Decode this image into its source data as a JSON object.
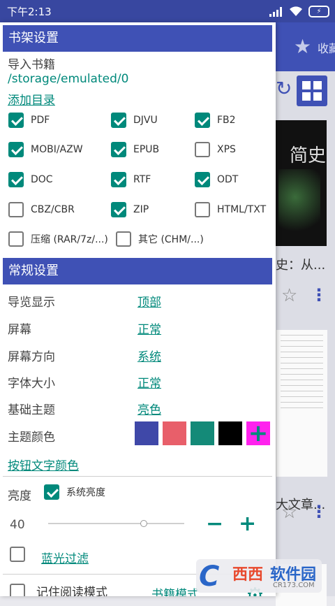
{
  "statusbar": {
    "time": "下午2:13",
    "battery": "⚡"
  },
  "background_app": {
    "toolbar_text": "收藏",
    "book1_cover_title": "简史",
    "book1_title": "史：从...",
    "book2_title": "大文章..."
  },
  "library_settings": {
    "header": "书架设置",
    "import_label": "导入书籍",
    "path": "/storage/emulated/0",
    "add_directory": "添加目录",
    "formats": [
      {
        "label": "PDF",
        "checked": true
      },
      {
        "label": "DJVU",
        "checked": true
      },
      {
        "label": "FB2",
        "checked": true
      },
      {
        "label": "MOBI/AZW",
        "checked": true
      },
      {
        "label": "EPUB",
        "checked": true
      },
      {
        "label": "XPS",
        "checked": false
      },
      {
        "label": "DOC",
        "checked": true
      },
      {
        "label": "RTF",
        "checked": true
      },
      {
        "label": "ODT",
        "checked": true
      },
      {
        "label": "CBZ/CBR",
        "checked": false
      },
      {
        "label": "ZIP",
        "checked": true
      },
      {
        "label": "HTML/TXT",
        "checked": false
      },
      {
        "label": "压缩 (RAR/7z/...)",
        "checked": false
      },
      {
        "label": "其它 (CHM/...)",
        "checked": false
      }
    ]
  },
  "general_settings": {
    "header": "常规设置",
    "rows": [
      {
        "label": "导览显示",
        "value": "顶部"
      },
      {
        "label": "屏幕",
        "value": "正常"
      },
      {
        "label": "屏幕方向",
        "value": "系统"
      },
      {
        "label": "字体大小",
        "value": "正常"
      },
      {
        "label": "基础主题",
        "value": "亮色"
      }
    ],
    "theme_color_label": "主题颜色",
    "theme_colors": [
      "#3f48a8",
      "#e85f6a",
      "#148a78",
      "#000000",
      "#ff22ee"
    ],
    "add_color_icon": "plus-icon",
    "button_text_color": "按钮文字颜色",
    "brightness_label": "亮度",
    "system_brightness": "系统亮度",
    "system_brightness_checked": true,
    "brightness_value": "40",
    "brightness_fraction": 0.7,
    "blue_filter": "蓝光过滤",
    "blue_filter_checked": false,
    "remember_mode": "记住阅读模式",
    "remember_mode_checked": false,
    "book_mode": "书籍模式"
  },
  "watermark": {
    "t1": "西西",
    "t2": "软件园",
    "t3": "CR173.COM"
  },
  "colors": {
    "accent": "#00897b",
    "primary": "#3f51b5"
  }
}
